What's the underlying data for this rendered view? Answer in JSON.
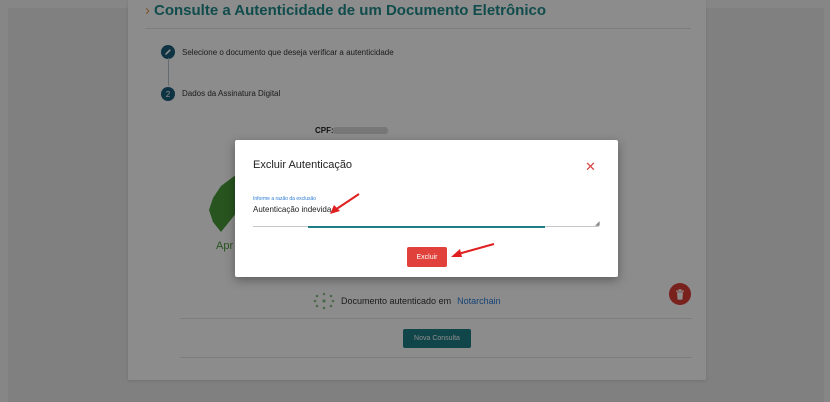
{
  "page": {
    "title_chevron": "›",
    "title": "Consulte a Autenticidade de um Documento Eletrônico"
  },
  "steps": [
    {
      "number": "",
      "label": "Selecione o documento que deseja verificar a autenticidade"
    },
    {
      "number": "2",
      "label": "Dados da Assinatura Digital"
    }
  ],
  "details": {
    "cpf_label": "CPF:",
    "approved_label": "Apr",
    "notarchain_text": "Documento autenticado em",
    "notarchain_link": "Notarchain"
  },
  "actions": {
    "new_query": "Nova Consulta"
  },
  "modal": {
    "title": "Excluir Autenticação",
    "close_symbol": "✕",
    "reason_label": "Informe a razão da exclusão",
    "reason_value": "Autenticação indevida",
    "delete_button": "Excluir"
  },
  "colors": {
    "accent_teal": "#1e7e88",
    "danger_red": "#e0413b",
    "annotation_arrow": "#e02020"
  },
  "icons": {
    "step1": "pencil-icon",
    "trash": "trash-icon",
    "badge": "approved-badge-icon",
    "notarchain": "notarchain-logo-icon"
  }
}
